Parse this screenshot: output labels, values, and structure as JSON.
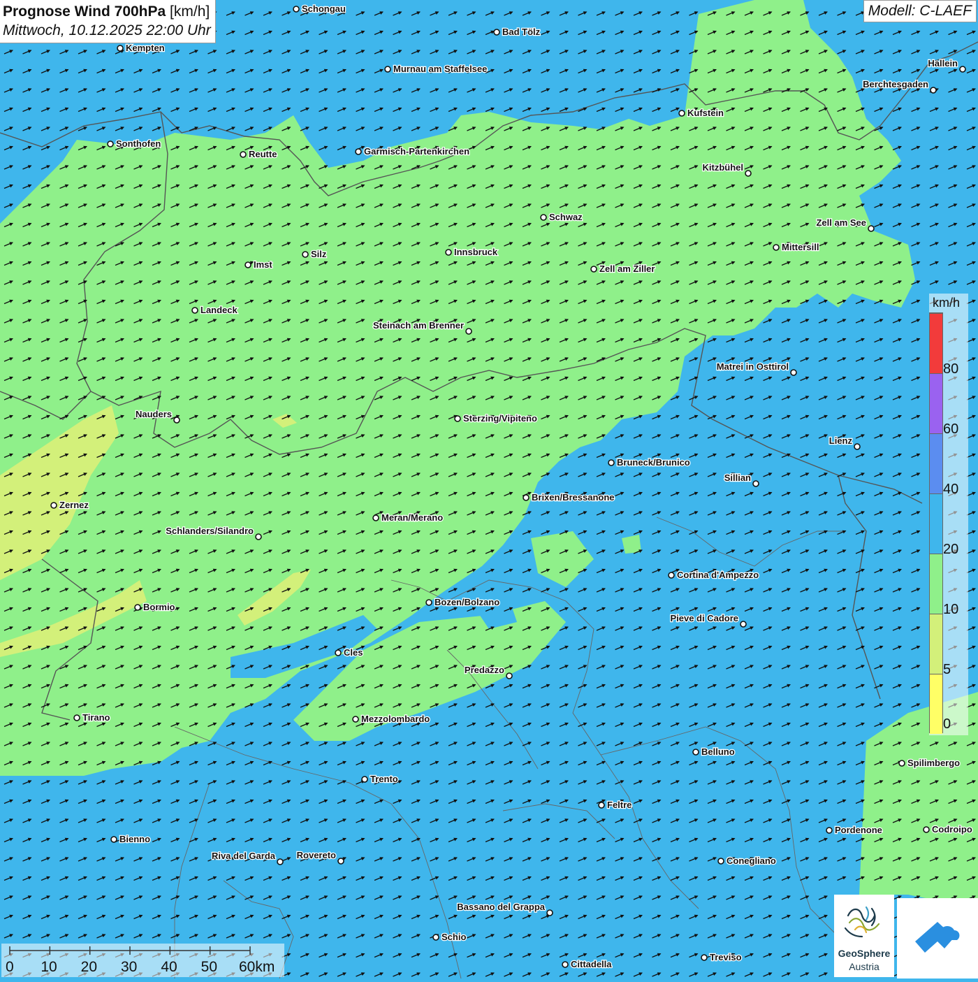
{
  "header": {
    "title_bold": "Prognose Wind 700hPa",
    "title_unit": "[km/h]",
    "datetime": "Mittwoch, 10.12.2025 22:00 Uhr",
    "model": "Modell: C-LAEF"
  },
  "legend": {
    "unit": "km/h",
    "classes": [
      {
        "min": 0,
        "max": 5,
        "color": "#ffff66"
      },
      {
        "min": 5,
        "max": 10,
        "color": "#d3f07a"
      },
      {
        "min": 10,
        "max": 20,
        "color": "#8ff08a"
      },
      {
        "min": 20,
        "max": 40,
        "color": "#3fb6ec"
      },
      {
        "min": 40,
        "max": 60,
        "color": "#5b8df0"
      },
      {
        "min": 60,
        "max": 80,
        "color": "#9a62f0"
      },
      {
        "min": 80,
        "max": null,
        "color": "#f23b3b"
      }
    ],
    "labels": [
      "0",
      "5",
      "10",
      "20",
      "40",
      "60",
      "80"
    ]
  },
  "scalebar": {
    "labels": [
      "0",
      "10",
      "20",
      "30",
      "40",
      "50",
      "60km"
    ]
  },
  "cities": [
    {
      "name": "Schongau"
    },
    {
      "name": "Bad Tölz"
    },
    {
      "name": "Kempten"
    },
    {
      "name": "Murnau am Staffelsee"
    },
    {
      "name": "Hallein"
    },
    {
      "name": "Berchtesgaden"
    },
    {
      "name": "Kufstein"
    },
    {
      "name": "Sonthofen"
    },
    {
      "name": "Reutte"
    },
    {
      "name": "Garmisch-Partenkirchen"
    },
    {
      "name": "Kitzbühel"
    },
    {
      "name": "Schwaz"
    },
    {
      "name": "Zell am See"
    },
    {
      "name": "Mittersill"
    },
    {
      "name": "Innsbruck"
    },
    {
      "name": "Silz"
    },
    {
      "name": "Imst"
    },
    {
      "name": "Zell am Ziller"
    },
    {
      "name": "Landeck"
    },
    {
      "name": "Steinach am Brenner"
    },
    {
      "name": "Matrei in Osttirol"
    },
    {
      "name": "Nauders"
    },
    {
      "name": "Sterzing/Vipiteno"
    },
    {
      "name": "Lienz"
    },
    {
      "name": "Bruneck/Brunico"
    },
    {
      "name": "Sillian"
    },
    {
      "name": "Zernez"
    },
    {
      "name": "Brixen/Bressanone"
    },
    {
      "name": "Meran/Merano"
    },
    {
      "name": "Schlanders/Silandro"
    },
    {
      "name": "Cortina d'Ampezzo"
    },
    {
      "name": "Bozen/Bolzano"
    },
    {
      "name": "Bormio"
    },
    {
      "name": "Pieve di Cadore"
    },
    {
      "name": "Cles"
    },
    {
      "name": "Predazzo"
    },
    {
      "name": "Tirano"
    },
    {
      "name": "Mezzolombardo"
    },
    {
      "name": "Belluno"
    },
    {
      "name": "Spilimbergo"
    },
    {
      "name": "Trento"
    },
    {
      "name": "Feltre"
    },
    {
      "name": "Pordenone"
    },
    {
      "name": "Codroipo"
    },
    {
      "name": "Bienno"
    },
    {
      "name": "Riva del Garda"
    },
    {
      "name": "Rovereto"
    },
    {
      "name": "Conegliano"
    },
    {
      "name": "Bassano del Grappa"
    },
    {
      "name": "Schio"
    },
    {
      "name": "Treviso"
    },
    {
      "name": "Cittadella"
    }
  ],
  "logos": {
    "geosphere_name": "GeoSphere",
    "geosphere_sub": "Austria"
  },
  "colors": {
    "wind_lt10": "#8ff08a",
    "wind_10_20": "#3fb6ec",
    "wind_5_10": "#d3f07a",
    "border": "#555555",
    "arrow": "#111111"
  }
}
